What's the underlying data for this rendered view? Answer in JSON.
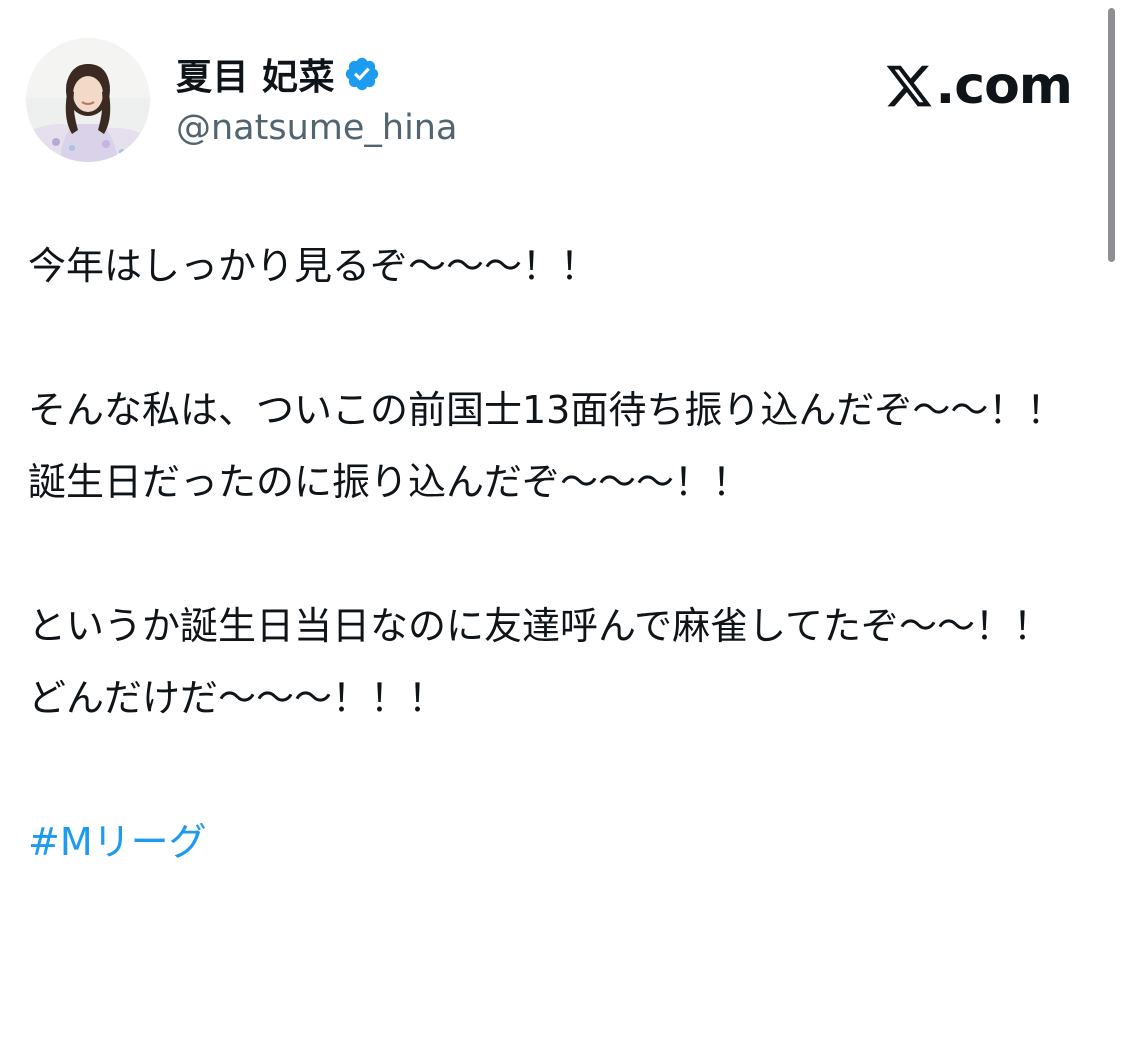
{
  "author": {
    "display_name": "夏目 妃菜",
    "handle": "@natsume_hina",
    "verified": true,
    "verified_icon": "verified-badge-icon",
    "avatar_icon": "profile-photo"
  },
  "brand": {
    "logo_icon": "x-logo-icon",
    "text": ".com"
  },
  "tweet": {
    "lines": [
      "今年はしっかり見るぞ〜〜〜！！",
      "そんな私は、ついこの前国士13面待ち振り込んだぞ〜〜！！",
      "誕生日だったのに振り込んだぞ〜〜〜！！",
      "というか誕生日当日なのに友達呼んで麻雀してたぞ〜〜！！",
      "どんだけだ〜〜〜！！！"
    ],
    "hashtag": "#Mリーグ"
  },
  "colors": {
    "text": "#0f1419",
    "secondary": "#536471",
    "accent": "#1d9bf0"
  }
}
